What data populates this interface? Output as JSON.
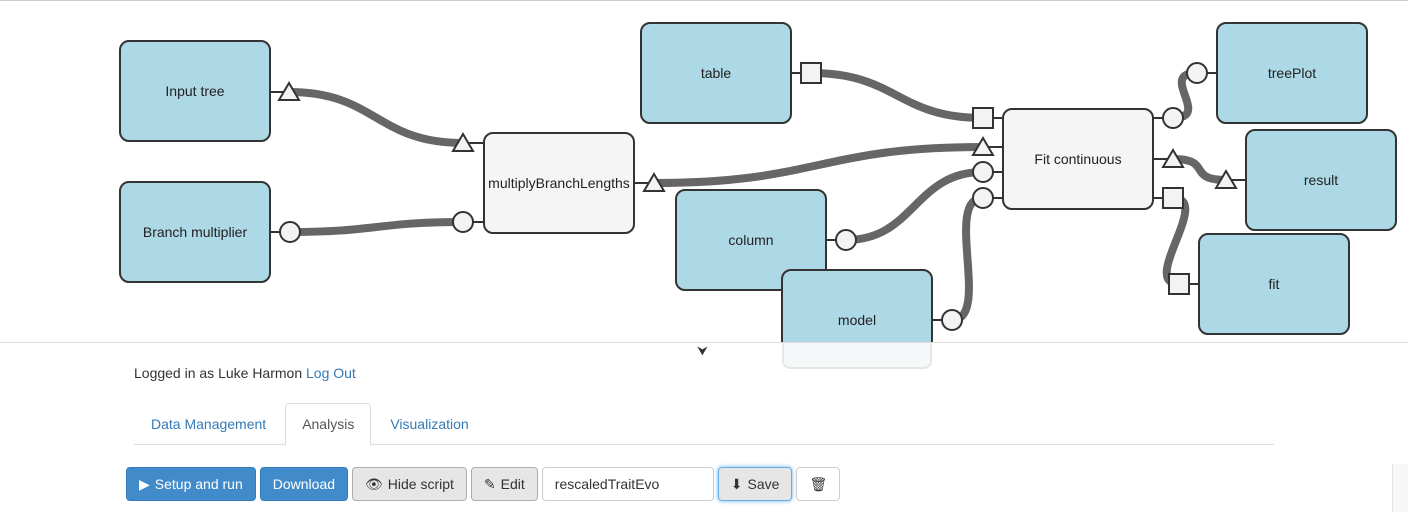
{
  "colors": {
    "input_node": "#add8e6",
    "process_node": "#f5f5f5",
    "edge": "#666666",
    "link": "#337ab7",
    "primary": "#428bca"
  },
  "graph": {
    "nodes": [
      {
        "id": "input_tree",
        "label": "Input tree",
        "kind": "input"
      },
      {
        "id": "branch_multiplier",
        "label": "Branch multiplier",
        "kind": "input"
      },
      {
        "id": "multiply",
        "label": "multiplyBranchLengths",
        "kind": "process"
      },
      {
        "id": "table",
        "label": "table",
        "kind": "input"
      },
      {
        "id": "column",
        "label": "column",
        "kind": "input"
      },
      {
        "id": "model",
        "label": "model",
        "kind": "input"
      },
      {
        "id": "fit_continuous",
        "label": "Fit continuous",
        "kind": "process"
      },
      {
        "id": "treeplot",
        "label": "treePlot",
        "kind": "output"
      },
      {
        "id": "result",
        "label": "result",
        "kind": "output"
      },
      {
        "id": "fit",
        "label": "fit",
        "kind": "output"
      }
    ],
    "edges": [
      {
        "from": "input_tree",
        "to": "multiply",
        "port_type": "tree"
      },
      {
        "from": "branch_multiplier",
        "to": "multiply",
        "port_type": "number"
      },
      {
        "from": "multiply",
        "to": "fit_continuous",
        "port_type": "tree"
      },
      {
        "from": "table",
        "to": "fit_continuous",
        "port_type": "table"
      },
      {
        "from": "column",
        "to": "fit_continuous",
        "port_type": "string"
      },
      {
        "from": "model",
        "to": "fit_continuous",
        "port_type": "string"
      },
      {
        "from": "fit_continuous",
        "to": "treeplot",
        "port_type": "image"
      },
      {
        "from": "fit_continuous",
        "to": "result",
        "port_type": "tree"
      },
      {
        "from": "fit_continuous",
        "to": "fit",
        "port_type": "table"
      }
    ]
  },
  "panel_toggle_icon": "chevron-down-icon",
  "login": {
    "prefix": "Logged in as Luke Harmon",
    "logout": "Log Out"
  },
  "tabs": [
    {
      "label": "Data Management",
      "active": false
    },
    {
      "label": "Analysis",
      "active": true
    },
    {
      "label": "Visualization",
      "active": false
    }
  ],
  "toolbar": {
    "setup_run": "Setup and run",
    "setup_run_icon": "play-icon",
    "download": "Download",
    "hide_script": "Hide script",
    "hide_script_icon": "eye-slash-icon",
    "edit": "Edit",
    "edit_icon": "edit-icon",
    "name_value": "rescaledTraitEvo",
    "save": "Save",
    "save_icon": "download-icon",
    "delete_icon": "trash-icon"
  }
}
